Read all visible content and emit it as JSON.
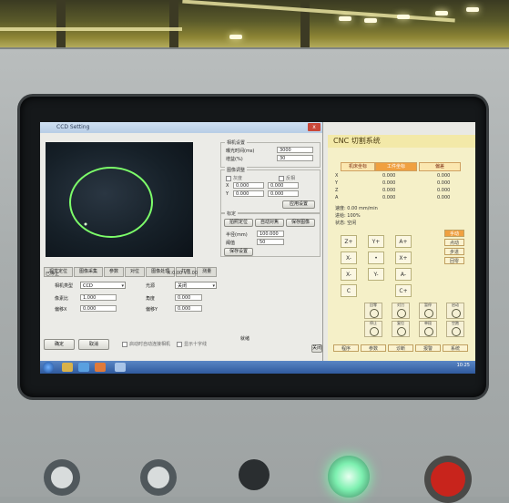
{
  "dialog": {
    "title": "CCD Setting",
    "close": "x",
    "group1_title": "相机设置",
    "row1_label": "曝光时间(ms)",
    "row1_value": "3000",
    "row2_label": "增益(%)",
    "row2_value": "30",
    "group2_title": "图像调整",
    "chk_a": "灰度",
    "chk_b": "反相",
    "row_x_label": "X",
    "row_x_value": "0.000",
    "row_y_label": "Y",
    "row_y_value": "0.000",
    "apply_btn": "应用设置",
    "group3_title": "标定",
    "btn_a": "拍照定位",
    "btn_b": "自动对焦",
    "btn_c": "保存图像",
    "row_r_label": "半径(mm)",
    "row_r_value": "100.000",
    "row_t_label": "阈值",
    "row_t_value": "50",
    "save_btn": "保存设置",
    "tabs": [
      "视觉定位",
      "图像采集",
      "参数",
      "对位",
      "图像处理",
      "打开",
      "测量"
    ],
    "status_left": "已停止",
    "status_right": "X:0.00 Y:0.00",
    "lower": {
      "label1": "相机类型",
      "select1": "CCD",
      "label2": "光源",
      "select2": "关闭",
      "label3": "像素比",
      "value3": "1.000",
      "label4": "角度",
      "value4": "0.000",
      "label5": "偏移X",
      "value5": "0.000",
      "label6": "偏移Y",
      "value6": "0.000"
    },
    "bottom_btn1": "确定",
    "bottom_btn2": "取消",
    "chk_opt1": "启动时自动连接相机",
    "chk_opt2": "显示十字线",
    "footer_label": "就绪",
    "cancel_small": "关闭"
  },
  "cnc": {
    "header": "CNC  切割系统",
    "tabs": [
      "机床坐标",
      "工件坐标",
      "偏差"
    ],
    "coords": [
      {
        "axis": "X",
        "v1": "0.000",
        "v2": "0.000"
      },
      {
        "axis": "Y",
        "v1": "0.000",
        "v2": "0.000"
      },
      {
        "axis": "Z",
        "v1": "0.000",
        "v2": "0.000"
      },
      {
        "axis": "A",
        "v1": "0.000",
        "v2": "0.000"
      }
    ],
    "info_lines": [
      "速度: 0.00 mm/min",
      "进给: 100%",
      "状态: 空闲"
    ],
    "jog": [
      "Z+",
      "Y+",
      "A+",
      "X-",
      "•",
      "X+",
      "X-",
      "Y-",
      "A-",
      "C",
      "C+"
    ],
    "side": [
      "手动",
      "点动",
      "步进",
      "回零"
    ],
    "icon_labels": [
      "回零",
      "对刀",
      "暂停",
      "启动",
      "停止",
      "复位",
      "单段",
      "空跑"
    ],
    "bottom_btns": [
      "程序",
      "参数",
      "诊断",
      "报警",
      "系统"
    ]
  },
  "taskbar": {
    "clock": "10:25"
  }
}
